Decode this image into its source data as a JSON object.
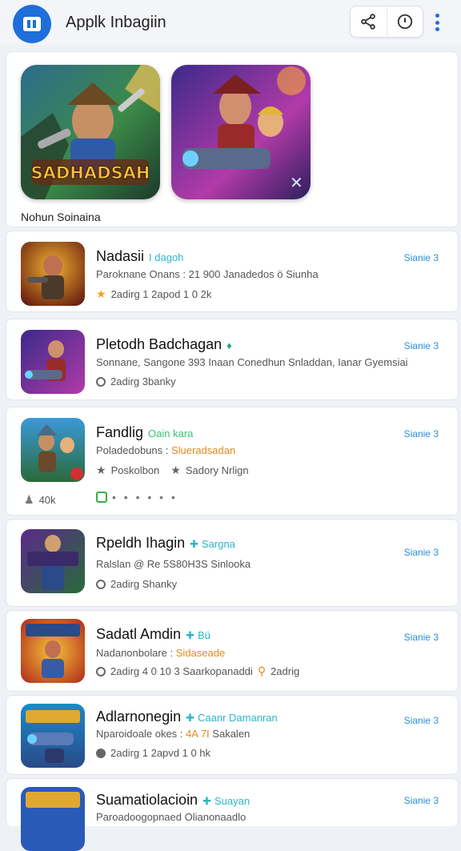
{
  "header": {
    "app_title": "Applk Inbagiin",
    "icons": {
      "logo": "app-logo",
      "share": "share-icon",
      "info": "clock-info-icon",
      "menu": "kebab-menu-icon"
    }
  },
  "featured": {
    "tile1_title": "SADHADSAH",
    "caption": "Nohun Soinaina"
  },
  "apps": [
    {
      "title": "Nadasii",
      "tag": "I dagoh",
      "subtitle": "Paroknane Onans : 21 900 Janadedos ö Siunha",
      "meta_icon": "star-icon",
      "meta": "2adirg 1 2apod 1 0 2k",
      "link": "Sianie 3"
    },
    {
      "title": "Pletodh Badchagan",
      "tag_icon": "flame-icon",
      "subtitle": "Sonnane, Sangone 393 Inaan Conedhun Snladdan, Ianar Gyemsiai",
      "meta_icon": "ring-icon",
      "meta": "2adirg 3banky",
      "link": "Sianie 3"
    },
    {
      "title": "Fandlig",
      "tag": "Oain kara",
      "subtitle_prefix": "Poladedobuns :",
      "subtitle_highlight": "Slueradsadan",
      "meta_a": "Poskolbon",
      "meta_b": "Sadory Nrlign",
      "extra_count": "40k",
      "extra_dots": "• • • • • •",
      "link": "Sianie 3"
    },
    {
      "title": "Rpeldh Ihagin",
      "tag": "Sargna",
      "subtitle": "Ralslan @ Re 5S80H3S Sinlooka",
      "meta_icon": "ring-icon",
      "meta": "2adirg Shanky",
      "link": "Sianie 3"
    },
    {
      "title": "Sadatl Amdin",
      "tag": "Bü",
      "subtitle_prefix": "Nadanonbolare :",
      "subtitle_highlight": "Sidaseade",
      "meta_a": "2adirg 4 0 10 3 Saarkopanaddi",
      "meta_b": "2adrig",
      "link": "Sianie 3"
    },
    {
      "title": "Adlarnonegin",
      "tag": "Caanr Damanran",
      "subtitle_prefix": "Nparoidoale okes :",
      "subtitle_highlight": "4A 7I",
      "subtitle_suffix": "Sakalen",
      "meta_icon": "ring-icon",
      "meta": "2adirg 1 2apvd 1 0 hk",
      "link": "Sianie 3"
    },
    {
      "title": "Suamatiolacioin",
      "tag": "Suayan",
      "subtitle": "Paroadoogopnaed Olianonaadlo",
      "link": "Sianie 3"
    }
  ],
  "colors": {
    "accent": "#1e6fd9",
    "link": "#2a8fd6",
    "tag": "#2db5c9",
    "highlight": "#e08a1e",
    "star": "#f0a21a"
  }
}
